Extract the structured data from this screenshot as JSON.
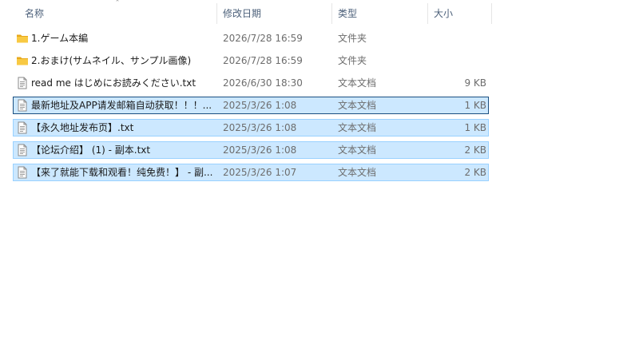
{
  "columns": {
    "name": "名称",
    "date": "修改日期",
    "type": "类型",
    "size": "大小"
  },
  "sort": {
    "indicator": "˄"
  },
  "files": [
    {
      "name": "1.ゲーム本編",
      "date": "2026/7/28 16:59",
      "type": "文件夹",
      "size": "",
      "icon": "folder-icon",
      "selected": false
    },
    {
      "name": "2.おまけ(サムネイル、サンプル画像)",
      "date": "2026/7/28 16:59",
      "type": "文件夹",
      "size": "",
      "icon": "folder-icon",
      "selected": false
    },
    {
      "name": "read me はじめにお読みください.txt",
      "date": "2026/6/30 18:30",
      "type": "文本文档",
      "size": "9 KB",
      "icon": "text-file-icon",
      "selected": false
    },
    {
      "name": "最新地址及APP请发邮箱自动获取！！！...",
      "date": "2025/3/26 1:08",
      "type": "文本文档",
      "size": "1 KB",
      "icon": "text-file-icon",
      "selected": true,
      "focused": true
    },
    {
      "name": "【永久地址发布页】.txt",
      "date": "2025/3/26 1:08",
      "type": "文本文档",
      "size": "1 KB",
      "icon": "text-file-icon",
      "selected": true
    },
    {
      "name": "【论坛介绍】 (1) - 副本.txt",
      "date": "2025/3/26 1:08",
      "type": "文本文档",
      "size": "2 KB",
      "icon": "text-file-icon",
      "selected": true
    },
    {
      "name": "【来了就能下载和观看！纯免费！】 - 副...",
      "date": "2025/3/26 1:07",
      "type": "文本文档",
      "size": "2 KB",
      "icon": "text-file-icon",
      "selected": true
    }
  ],
  "colors": {
    "folder": "#f8c943",
    "folder_dark": "#e8a91c",
    "selection_bg": "#cce8ff",
    "selection_border": "#99d1ff",
    "focus_border": "#1a4f80"
  }
}
